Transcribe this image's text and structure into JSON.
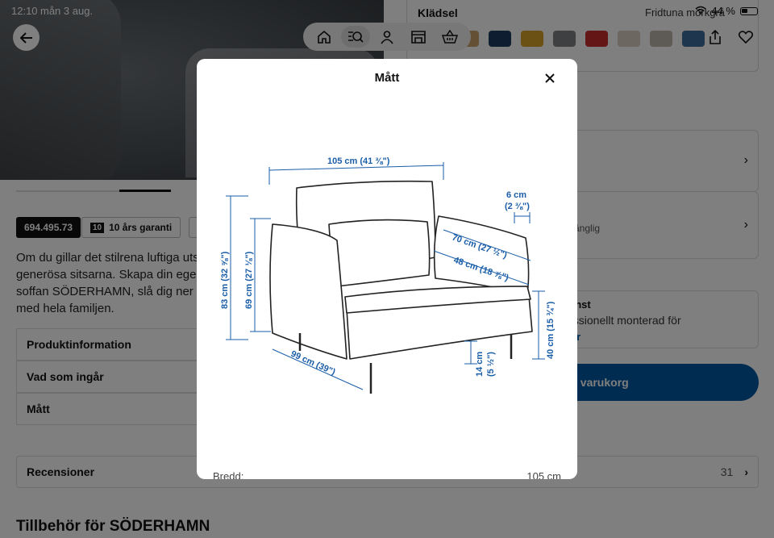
{
  "status_bar": {
    "time": "12:10",
    "date": "mån 3 aug.",
    "battery": "44 %"
  },
  "tabbar": {
    "items": [
      {
        "icon": "home-icon"
      },
      {
        "icon": "browse-search-icon",
        "active": true
      },
      {
        "icon": "profile-icon"
      },
      {
        "icon": "store-icon"
      },
      {
        "icon": "basket-icon"
      }
    ]
  },
  "right_panel": {
    "section_title": "Klädsel",
    "selected_color": "Fridtuna mörkgrå",
    "swatch_colors": [
      "#c9a36a",
      "#1d3a5f",
      "#d8a22a",
      "#7d8085",
      "#c92a2a",
      "#d9cfc3",
      "#bdb6ad",
      "#3d6f9c"
    ],
    "row2_suffix": ")",
    "row2_detail": "llgänglig",
    "service_title": "änst",
    "service_text": "essionellt monterad för",
    "service_link": "ner",
    "cart_label": "i varukorg"
  },
  "product": {
    "article_number": "694.495.73",
    "warranty_number": "10",
    "warranty_label": "10 års garanti",
    "description": "Om du gillar det stilrena luftiga uts generösa sitsarna. Skapa din egen soffan SÖDERHAMN, slå dig ner oc med hela familjen.",
    "accordion": [
      "Produktinformation",
      "Vad som ingår",
      "Mått"
    ],
    "reviews_label": "Recensioner",
    "reviews_count": "31",
    "accessories_title": "Tillbehör för SÖDERHAMN"
  },
  "modal": {
    "title": "Mått",
    "dimensions": {
      "width": "105 cm (41 ⅜\")",
      "armrest": "6 cm",
      "armrest_in": "(2 ⅜\")",
      "seat_depth_total": "70 cm (27 ½\")",
      "seat_depth": "48 cm (18 ⅞\")",
      "height": "83 cm (32 ⅝\")",
      "back_height": "69 cm (27 ⅛\")",
      "seat_height": "40 cm (15 ¾\")",
      "leg_height": "14 cm",
      "leg_height_in": "(5 ½\")",
      "depth": "99 cm (39\")"
    },
    "spec_label": "Bredd:",
    "spec_value": "105 cm"
  }
}
